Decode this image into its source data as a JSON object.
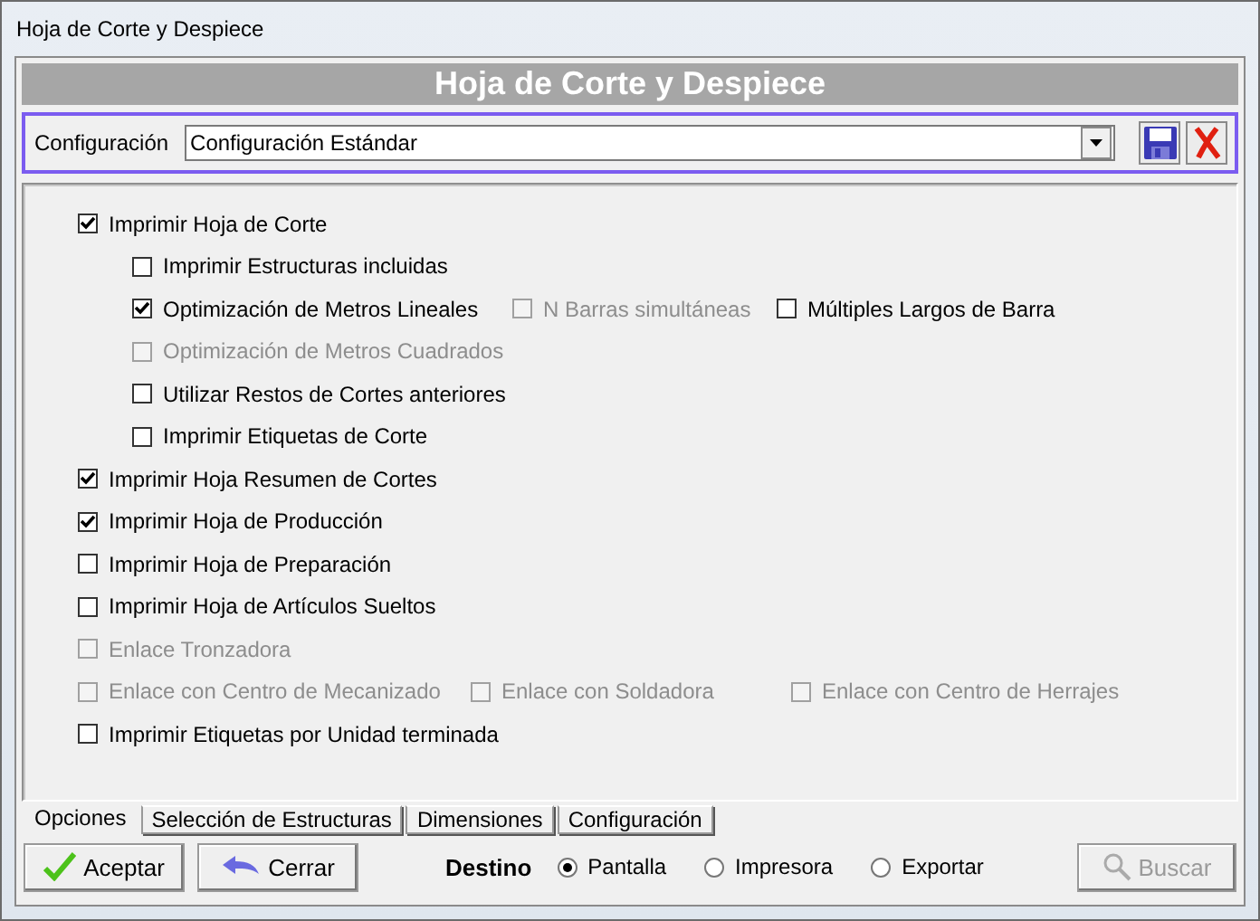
{
  "window": {
    "title": "Hoja de Corte y Despiece"
  },
  "header": {
    "title": "Hoja de Corte y Despiece"
  },
  "config": {
    "label": "Configuración",
    "value": "Configuración Estándar"
  },
  "options": [
    {
      "checks": [
        {
          "label": "Imprimir Hoja de Corte",
          "checked": true,
          "disabled": false
        }
      ],
      "children": [
        {
          "checks": [
            {
              "label": "Imprimir Estructuras incluidas",
              "checked": false,
              "disabled": false
            }
          ]
        },
        {
          "checks": [
            {
              "label": "Optimización de Metros Lineales",
              "checked": true,
              "disabled": false
            },
            {
              "label": "N Barras simultáneas",
              "checked": false,
              "disabled": true
            },
            {
              "label": "Múltiples Largos de Barra",
              "checked": false,
              "disabled": false
            }
          ]
        },
        {
          "checks": [
            {
              "label": "Optimización de Metros Cuadrados",
              "checked": false,
              "disabled": true
            }
          ]
        },
        {
          "checks": [
            {
              "label": "Utilizar Restos de Cortes anteriores",
              "checked": false,
              "disabled": false
            }
          ]
        },
        {
          "checks": [
            {
              "label": "Imprimir Etiquetas de Corte",
              "checked": false,
              "disabled": false
            }
          ]
        }
      ]
    },
    {
      "checks": [
        {
          "label": "Imprimir Hoja Resumen de Cortes",
          "checked": true,
          "disabled": false
        }
      ]
    },
    {
      "checks": [
        {
          "label": "Imprimir Hoja de Producción",
          "checked": true,
          "disabled": false
        }
      ]
    },
    {
      "checks": [
        {
          "label": "Imprimir Hoja de Preparación",
          "checked": false,
          "disabled": false
        }
      ]
    },
    {
      "checks": [
        {
          "label": "Imprimir Hoja de Artículos Sueltos",
          "checked": false,
          "disabled": false
        }
      ]
    },
    {
      "checks": [
        {
          "label": "Enlace Tronzadora",
          "checked": false,
          "disabled": true
        }
      ]
    },
    {
      "checks": [
        {
          "label": "Enlace con Centro de Mecanizado",
          "checked": false,
          "disabled": true
        },
        {
          "label": "Enlace con Soldadora",
          "checked": false,
          "disabled": true
        },
        {
          "label": "Enlace con Centro de Herrajes",
          "checked": false,
          "disabled": true
        }
      ]
    },
    {
      "checks": [
        {
          "label": "Imprimir Etiquetas por Unidad terminada",
          "checked": false,
          "disabled": false
        }
      ]
    }
  ],
  "tabs": [
    {
      "label": "Opciones",
      "selected": true
    },
    {
      "label": "Selección de Estructuras",
      "selected": false
    },
    {
      "label": "Dimensiones",
      "selected": false
    },
    {
      "label": "Configuración",
      "selected": false
    }
  ],
  "buttons": [
    {
      "kind": "accept",
      "label": "Aceptar",
      "disabled": false
    },
    {
      "kind": "close",
      "label": "Cerrar",
      "disabled": false
    }
  ],
  "destino": {
    "label": "Destino",
    "options": [
      {
        "label": "Pantalla",
        "selected": true
      },
      {
        "label": "Impresora",
        "selected": false
      },
      {
        "label": "Exportar",
        "selected": false
      }
    ]
  },
  "search_button": {
    "label": "Buscar",
    "disabled": true
  }
}
